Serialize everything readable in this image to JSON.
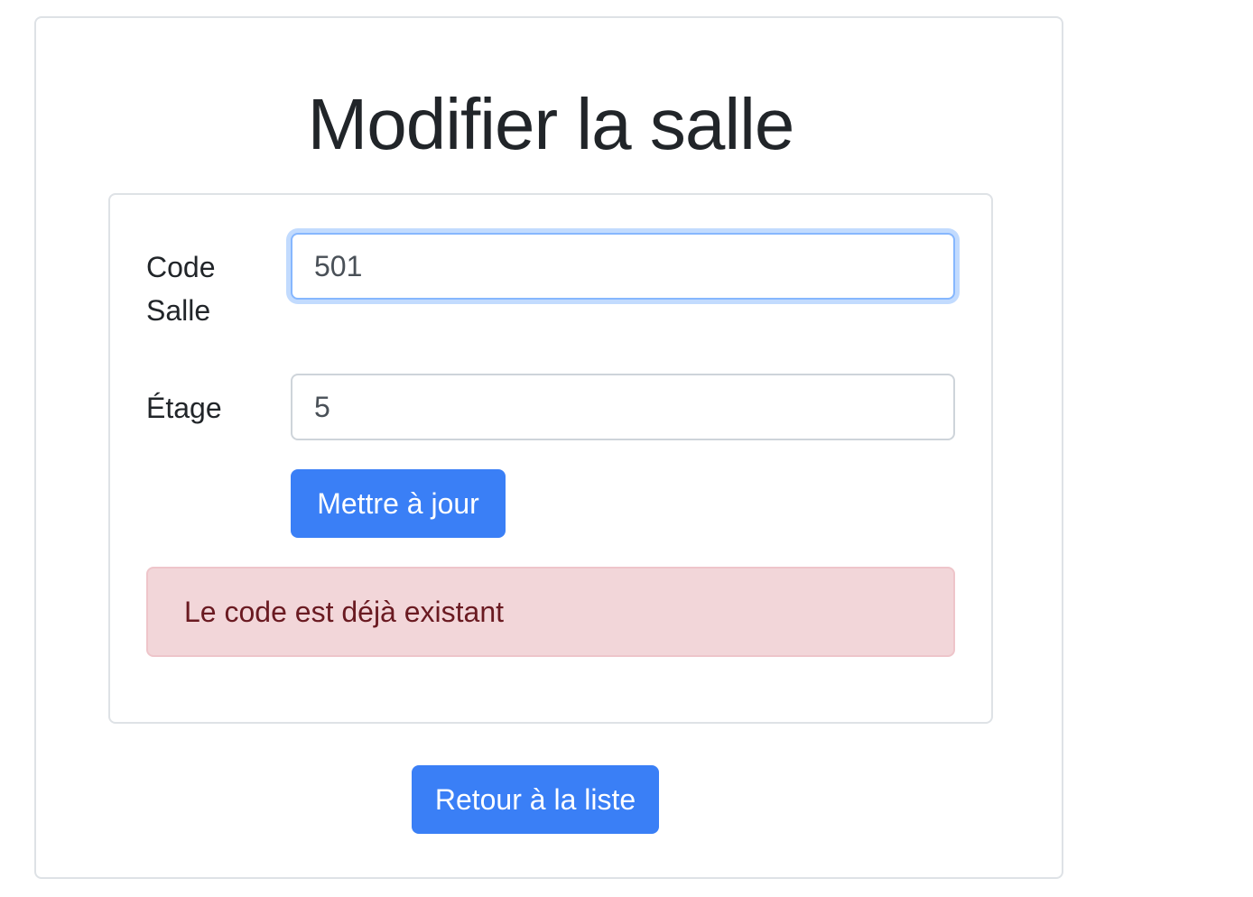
{
  "page": {
    "title": "Modifier la salle"
  },
  "form": {
    "code_label": "Code Salle",
    "code_value": "501",
    "etage_label": "Étage",
    "etage_value": "5",
    "submit_label": "Mettre à jour"
  },
  "alert": {
    "message": "Le code est déjà existant",
    "type": "danger"
  },
  "footer": {
    "back_label": "Retour à la liste"
  },
  "colors": {
    "primary": "#3a7ff6",
    "alert_bg": "#f2d6d9",
    "alert_text": "#6a1a21",
    "focus_border": "#86b7fe"
  }
}
